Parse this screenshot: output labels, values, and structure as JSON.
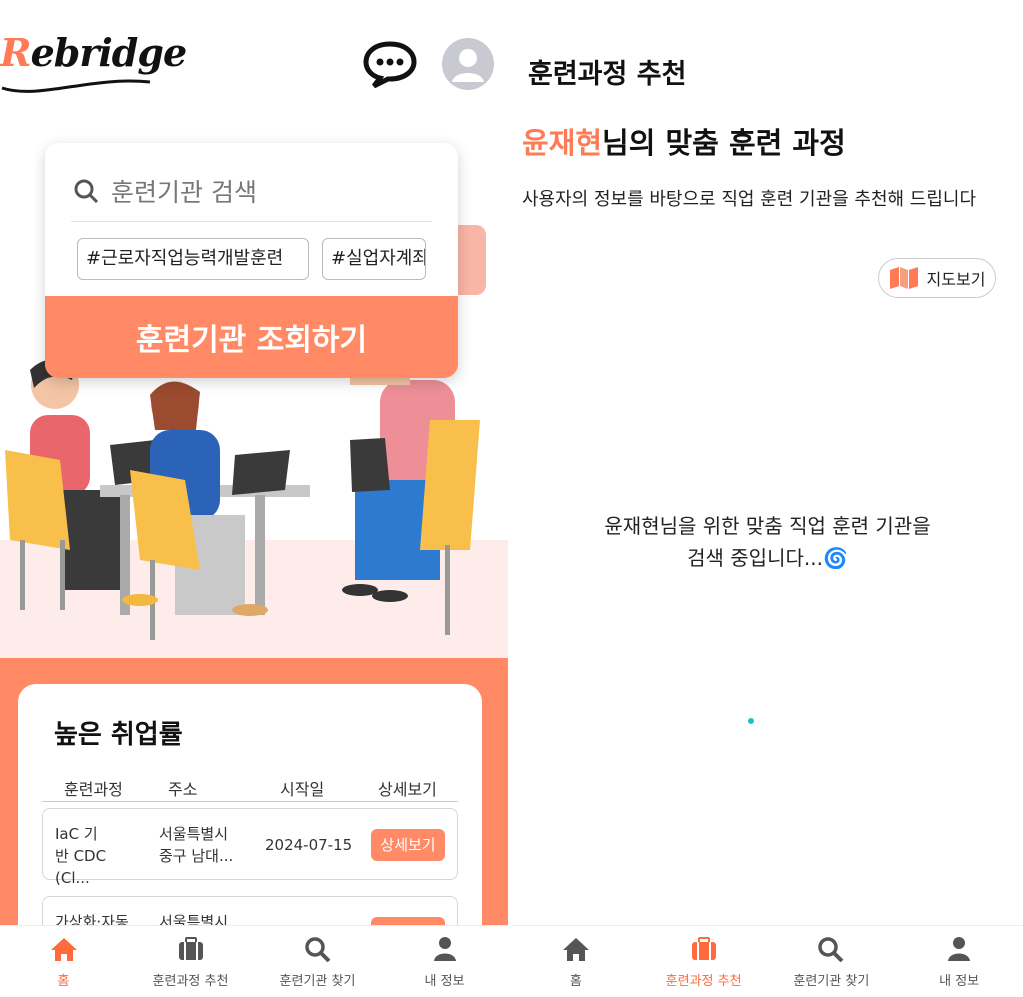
{
  "left": {
    "logo": {
      "initial": "R",
      "rest": "ebridge"
    },
    "search": {
      "placeholder": "훈련기관 검색",
      "tags": [
        "#근로자직업능력개발훈련",
        "#실업자계좌"
      ],
      "button_label": "훈련기관 조회하기"
    },
    "jobs": {
      "title": "높은 취업률",
      "columns": [
        "훈련과정",
        "주소",
        "시작일",
        "상세보기"
      ],
      "rows": [
        {
          "course": "IaC 기반 CDC (Cl...",
          "course_l1": "IaC 기",
          "course_l2": "반 CDC (Cl...",
          "addr_l1": "서울특별시",
          "addr_l2": "중구 남대...",
          "start": "2024-07-15",
          "detail": "상세보기"
        },
        {
          "course_l1": "가상화·자동",
          "addr_l1": "서울특별시"
        }
      ]
    },
    "nav": [
      {
        "label": "홈",
        "icon": "home-icon",
        "active": true
      },
      {
        "label": "훈련과정 추천",
        "icon": "briefcase-icon",
        "active": false
      },
      {
        "label": "훈련기관 찾기",
        "icon": "search-icon",
        "active": false
      },
      {
        "label": "내 정보",
        "icon": "user-icon",
        "active": false
      }
    ]
  },
  "right": {
    "title": "훈련과정 추천",
    "user_name": "윤재현",
    "subtitle_suffix": "님의 맞춤 훈련 과정",
    "description": "사용자의 정보를 바탕으로 직업 훈련 기관을 추천해 드립니다",
    "map_button": "지도보기",
    "loading_line1": "윤재현님을 위한 맞춤 직업 훈련 기관을",
    "loading_line2": "검색 중입니다...🌀",
    "nav": [
      {
        "label": "홈",
        "icon": "home-icon",
        "active": false
      },
      {
        "label": "훈련과정 추천",
        "icon": "briefcase-icon",
        "active": true
      },
      {
        "label": "훈련기관 찾기",
        "icon": "search-icon",
        "active": false
      },
      {
        "label": "내 정보",
        "icon": "user-icon",
        "active": false
      }
    ]
  },
  "colors": {
    "accent": "#ff8a65",
    "accent_text": "#ff7a55",
    "floor": "#fdecea"
  }
}
